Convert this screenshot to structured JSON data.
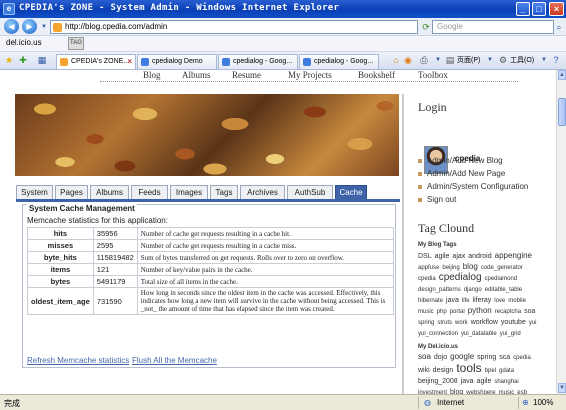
{
  "window": {
    "title": "CPEDIA's ZONE - System Admin - Windows Internet Explorer"
  },
  "address": {
    "url": "http://blog.cpedia.com/admin",
    "search_placeholder": "Google"
  },
  "links_bar": {
    "delicious": "del.icio.us",
    "tag": "TAG"
  },
  "browser_tabs": [
    {
      "label": "CPEDIA's ZONE...",
      "active": true
    },
    {
      "label": "cpedialog Demo",
      "active": false
    },
    {
      "label": "cpedialog - Goog...",
      "active": false
    },
    {
      "label": "cpedialog - Goog...",
      "active": false
    }
  ],
  "toolbar_right": {
    "page": "页面(P)",
    "tools": "工具(O)"
  },
  "top_nav": [
    "Blog",
    "Albums",
    "Resume",
    "My Projects",
    "Bookshelf",
    "Toolbox"
  ],
  "page_tabs": [
    "System",
    "Pages",
    "Albums",
    "Feeds",
    "Images",
    "Tags",
    "Archives",
    "AuthSub",
    "Cache"
  ],
  "active_tab": "Cache",
  "cache": {
    "heading": "System Cache Management",
    "intro": "Memcache statistics for this application:",
    "rows": [
      {
        "key": "hits",
        "value": "35956",
        "desc": "Number of cache get requests resulting in a cache hit."
      },
      {
        "key": "misses",
        "value": "2595",
        "desc": "Number of cache get requests resulting in a cache miss."
      },
      {
        "key": "byte_hits",
        "value": "115819482",
        "desc": "Sum of bytes transferred on get requests. Rolls over to zero on overflow."
      },
      {
        "key": "items",
        "value": "121",
        "desc": "Number of key/value pairs in the cache."
      },
      {
        "key": "bytes",
        "value": "5491179",
        "desc": "Total size of all items in the cache."
      },
      {
        "key": "oldest_item_age",
        "value": "731590",
        "desc": "How long in seconds since the oldest item in the cache was accessed. Effectively, this indicates how long a new item will survive in the cache without being accessed. This is _not_ the amount of time that has elapsed since the item was created."
      }
    ],
    "refresh_link": "Refresh Memcache statistics",
    "flush_link": "Flush All the Memcache"
  },
  "sidebar": {
    "login_title": "Login",
    "username": "cpedia",
    "menu": [
      "Admin/Add New Blog",
      "Admin/Add New Page",
      "Admin/System Configuration",
      "Sign out"
    ],
    "tag_title": "Tag Clound",
    "my_blog_tags_label": "My Blog Tags",
    "my_blog_tags": [
      {
        "t": "DSL",
        "s": 7
      },
      {
        "t": "agile",
        "s": 7
      },
      {
        "t": "ajax",
        "s": 7
      },
      {
        "t": "android",
        "s": 7
      },
      {
        "t": "appengine",
        "s": 8
      },
      {
        "t": "appfuse",
        "s": 6
      },
      {
        "t": "beijing",
        "s": 6
      },
      {
        "t": "blog",
        "s": 8
      },
      {
        "t": "code_generator",
        "s": 6
      },
      {
        "t": "cpedia",
        "s": 6
      },
      {
        "t": "cpedialog",
        "s": 10
      },
      {
        "t": "cpediamond",
        "s": 6
      },
      {
        "t": "design_patterns",
        "s": 6
      },
      {
        "t": "django",
        "s": 6
      },
      {
        "t": "editable_table",
        "s": 6
      },
      {
        "t": "hibernate",
        "s": 6
      },
      {
        "t": "java",
        "s": 7
      },
      {
        "t": "life",
        "s": 6
      },
      {
        "t": "liferay",
        "s": 7
      },
      {
        "t": "love",
        "s": 6
      },
      {
        "t": "mobile",
        "s": 6
      },
      {
        "t": "music",
        "s": 6
      },
      {
        "t": "php",
        "s": 6
      },
      {
        "t": "portal",
        "s": 6
      },
      {
        "t": "python",
        "s": 8
      },
      {
        "t": "recaptcha",
        "s": 6
      },
      {
        "t": "soa",
        "s": 7
      },
      {
        "t": "spring",
        "s": 6
      },
      {
        "t": "struts",
        "s": 6
      },
      {
        "t": "work",
        "s": 6
      },
      {
        "t": "workflow",
        "s": 7
      },
      {
        "t": "youtube",
        "s": 7
      },
      {
        "t": "yui",
        "s": 6
      },
      {
        "t": "yui_connection",
        "s": 6
      },
      {
        "t": "yui_datatable",
        "s": 6
      },
      {
        "t": "yui_grid",
        "s": 6
      }
    ],
    "delicious_label": "My Del.icio.us",
    "delicious_tags": [
      {
        "t": "soa",
        "s": 8
      },
      {
        "t": "dojo",
        "s": 7
      },
      {
        "t": "google",
        "s": 8
      },
      {
        "t": "spring",
        "s": 7
      },
      {
        "t": "sca",
        "s": 7
      },
      {
        "t": "cpedia",
        "s": 6
      },
      {
        "t": "wiki",
        "s": 7
      },
      {
        "t": "design",
        "s": 7
      },
      {
        "t": "tools",
        "s": 12
      },
      {
        "t": "bpel",
        "s": 6
      },
      {
        "t": "gdata",
        "s": 6
      },
      {
        "t": "beijing_2008",
        "s": 7
      },
      {
        "t": "java",
        "s": 7
      },
      {
        "t": "agile",
        "s": 7
      },
      {
        "t": "shanghai",
        "s": 6
      },
      {
        "t": "investment",
        "s": 6
      },
      {
        "t": "blog",
        "s": 7
      },
      {
        "t": "webshpere",
        "s": 6
      },
      {
        "t": "music",
        "s": 6
      },
      {
        "t": "esb",
        "s": 6
      }
    ]
  },
  "statusbar": {
    "left": "完成",
    "zone": "Internet",
    "zoom": "100%"
  }
}
